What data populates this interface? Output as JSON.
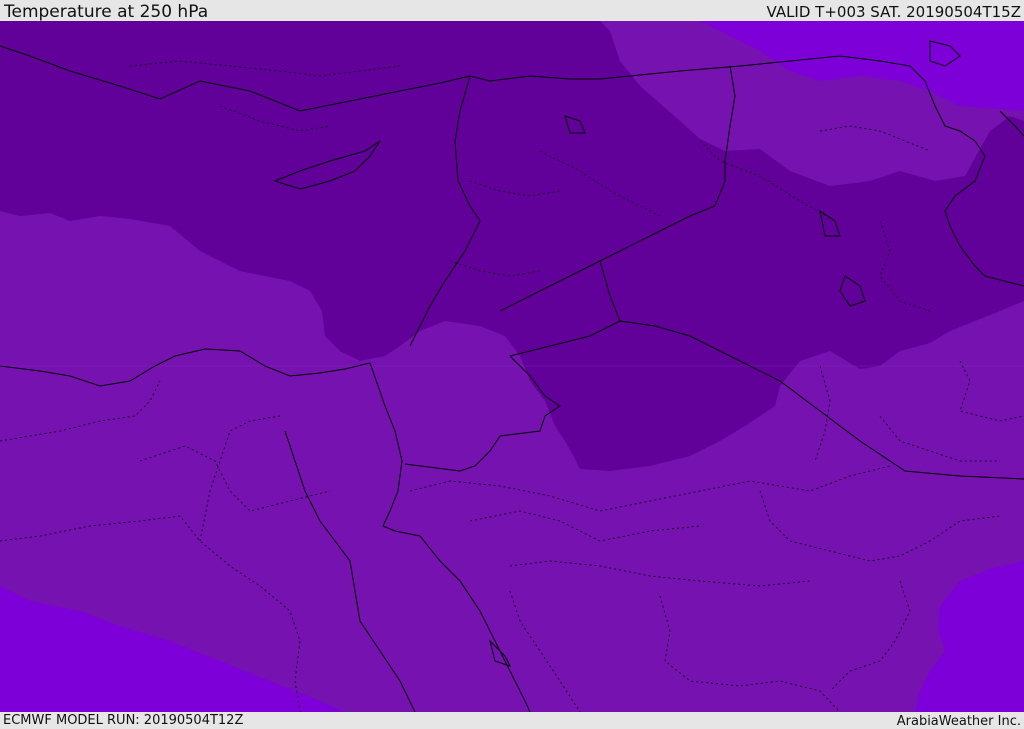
{
  "header": {
    "title": "Temperature at 250 hPa",
    "valid": "VALID T+003 SAT. 20190504T15Z"
  },
  "footer": {
    "model_run": "ECMWF MODEL RUN: 20190504T12Z",
    "credit": "ArabiaWeather Inc."
  },
  "map": {
    "fill_colors": {
      "cold": "#62009a",
      "mid": "#7612b0",
      "warm": "#7d00d8"
    },
    "line_color": "#000000"
  }
}
